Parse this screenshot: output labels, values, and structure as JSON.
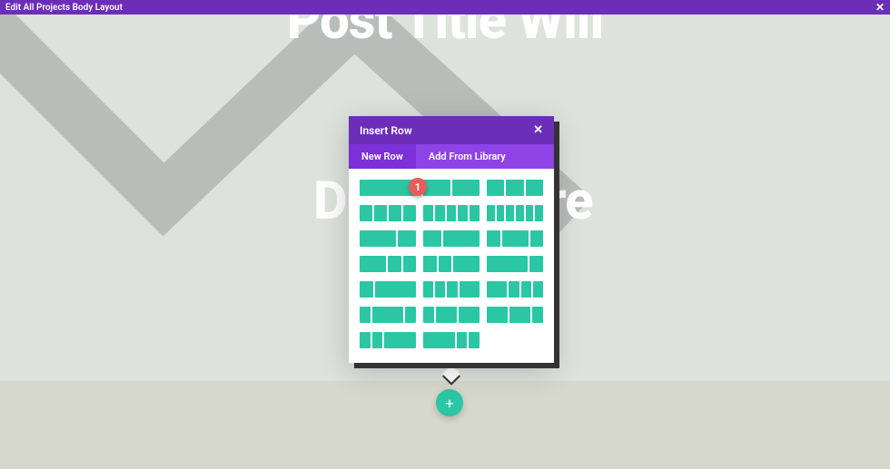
{
  "topbar": {
    "title": "Edit All Projects Body Layout"
  },
  "hero": {
    "line1": "Post Title Will",
    "line2": "Di",
    "line3": "re"
  },
  "modal": {
    "title": "Insert Row",
    "tabs": {
      "new": "New Row",
      "library": "Add From Library"
    }
  },
  "marker": {
    "label": "1"
  },
  "addButton": {
    "glyph": "+"
  },
  "colors": {
    "accent": "#6c2eb9",
    "teal": "#2bc7a4"
  }
}
